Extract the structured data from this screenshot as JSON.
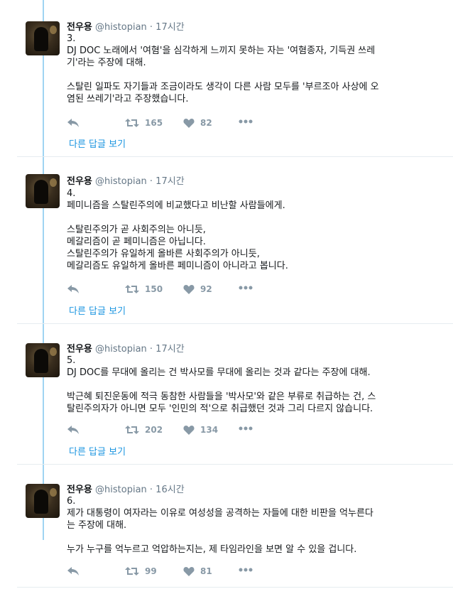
{
  "tweets": [
    {
      "name": "전우용",
      "handle": "@histopian",
      "time": "· 17시간",
      "text": "3.\nDJ DOC 노래에서 '여혐'을 심각하게 느끼지 못하는 자는 '여혐종자, 기득권 쓰레\n기'라는 주장에 대해.\n\n스탈린 일파도 자기들과 조금이라도 생각이 다른 사람 모두를 '부르조아 사상에 오\n염된 쓰레기'라고 주장했습니다.",
      "retweets": "165",
      "likes": "82",
      "more_replies": "다른 답글 보기"
    },
    {
      "name": "전우용",
      "handle": "@histopian",
      "time": "· 17시간",
      "text": "4.\n페미니즘을 스탈린주의에 비교했다고 비난할 사람들에게.\n\n스탈린주의가 곧 사회주의는 아니듯,\n메갈리즘이 곧 페미니즘은 아닙니다.\n스탈린주의가 유일하게 올바른 사회주의가 아니듯,\n메갈리즘도 유일하게 올바른 페미니즘이 아니라고 봅니다.",
      "retweets": "150",
      "likes": "92",
      "more_replies": "다른 답글 보기"
    },
    {
      "name": "전우용",
      "handle": "@histopian",
      "time": "· 17시간",
      "text": "5.\nDJ DOC를 무대에 올리는 건 박사모를 무대에 올리는 것과 같다는 주장에 대해.\n\n박근혜 퇴진운동에 적극 동참한 사람들을 '박사모'와 같은 부류로 취급하는 건, 스\n탈린주의자가 아니면 모두 '인민의 적'으로 취급했던 것과 그리 다르지 않습니다.",
      "retweets": "202",
      "likes": "134",
      "more_replies": "다른 답글 보기"
    },
    {
      "name": "전우용",
      "handle": "@histopian",
      "time": "· 16시간",
      "text": "6.\n제가 대통령이 여자라는 이유로 여성성을 공격하는 자들에 대한 비판을 억누른다\n는 주장에 대해.\n\n누가 누구를 억누르고 억압하는지는, 제 타임라인을 보면 알 수 있을 겁니다.",
      "retweets": "99",
      "likes": "81"
    }
  ],
  "colors": {
    "thread_line": "#9fd4f2",
    "link": "#1b95e0",
    "muted": "#8899a6"
  }
}
